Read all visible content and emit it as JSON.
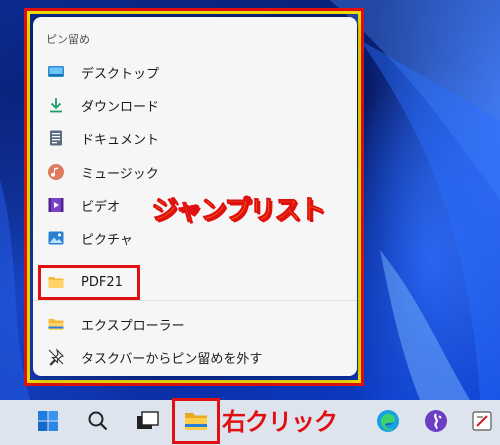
{
  "jumplist": {
    "section_header": "ピン留め",
    "items": [
      {
        "label": "デスクトップ",
        "icon": "desktop-icon"
      },
      {
        "label": "ダウンロード",
        "icon": "download-icon"
      },
      {
        "label": "ドキュメント",
        "icon": "document-icon"
      },
      {
        "label": "ミュージック",
        "icon": "music-icon"
      },
      {
        "label": "ビデオ",
        "icon": "video-icon"
      },
      {
        "label": "ピクチャ",
        "icon": "pictures-icon"
      },
      {
        "label": "PDF21",
        "icon": "folder-icon"
      }
    ],
    "actions": [
      {
        "label": "エクスプローラー",
        "icon": "file-explorer-icon"
      },
      {
        "label": "タスクバーからピン留めを外す",
        "icon": "unpin-icon"
      }
    ]
  },
  "annotations": {
    "jumplist_label": "ジャンプリスト",
    "right_click_label": "右クリック"
  },
  "taskbar": {
    "buttons": [
      {
        "icon": "start-icon"
      },
      {
        "icon": "search-icon"
      },
      {
        "icon": "task-view-icon"
      },
      {
        "icon": "file-explorer-icon"
      },
      {
        "icon": "edge-icon"
      },
      {
        "icon": "app-icon"
      },
      {
        "icon": "app-icon-2"
      }
    ]
  },
  "colors": {
    "highlight_red": "#e01010",
    "highlight_yellow": "#f2e000",
    "annotation_yellow": "#ffe800"
  }
}
